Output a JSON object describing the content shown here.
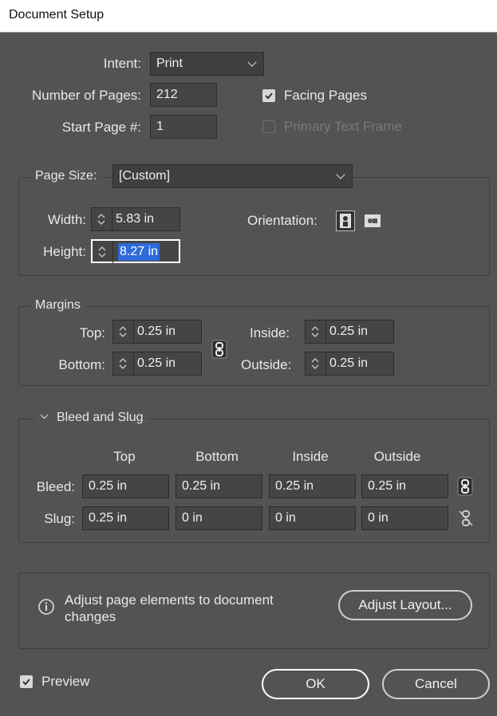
{
  "window": {
    "title": "Document Setup"
  },
  "intent": {
    "label": "Intent:",
    "value": "Print"
  },
  "pages": {
    "label": "Number of Pages:",
    "value": "212"
  },
  "start_page": {
    "label": "Start Page #:",
    "value": "1"
  },
  "facing_pages": {
    "label": "Facing Pages",
    "checked": true
  },
  "primary_text_frame": {
    "label": "Primary Text Frame",
    "checked": false,
    "enabled": false
  },
  "page_size": {
    "label": "Page Size:",
    "value": "[Custom]",
    "width_label": "Width:",
    "width": "5.83 in",
    "height_label": "Height:",
    "height": "8.27 in",
    "orientation_label": "Orientation:"
  },
  "margins": {
    "title": "Margins",
    "top_label": "Top:",
    "top": "0.25 in",
    "bottom_label": "Bottom:",
    "bottom": "0.25 in",
    "inside_label": "Inside:",
    "inside": "0.25 in",
    "outside_label": "Outside:",
    "outside": "0.25 in"
  },
  "bleed_slug": {
    "title": "Bleed and Slug",
    "columns": [
      "Top",
      "Bottom",
      "Inside",
      "Outside"
    ],
    "bleed_label": "Bleed:",
    "bleed": [
      "0.25 in",
      "0.25 in",
      "0.25 in",
      "0.25 in"
    ],
    "slug_label": "Slug:",
    "slug": [
      "0.25 in",
      "0 in",
      "0 in",
      "0 in"
    ]
  },
  "adjust": {
    "message": "Adjust page elements to document changes",
    "button": "Adjust Layout..."
  },
  "preview": {
    "label": "Preview",
    "checked": true
  },
  "buttons": {
    "ok": "OK",
    "cancel": "Cancel"
  }
}
